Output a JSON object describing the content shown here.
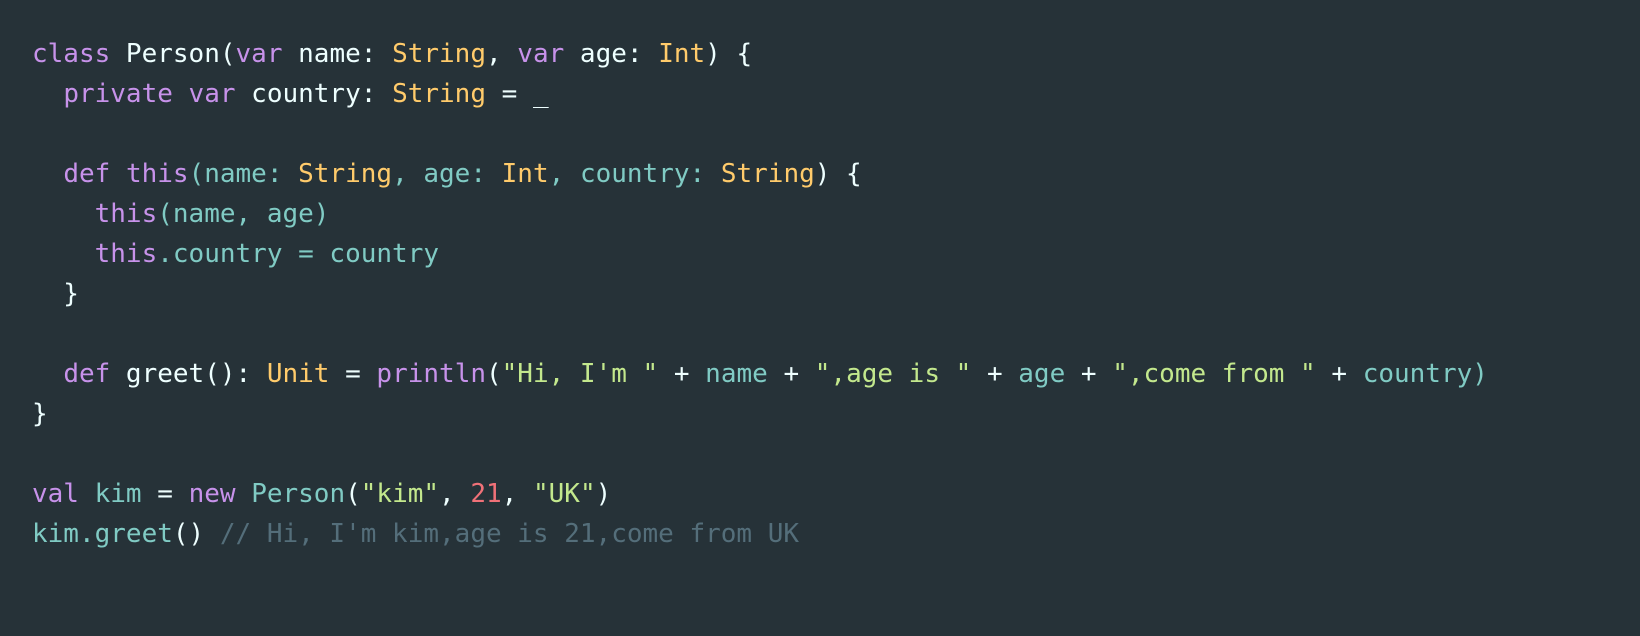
{
  "editor": {
    "language": "scala",
    "background_color": "#263238",
    "font_size_px": 26,
    "line_height_px": 40
  },
  "theme": {
    "keyword": "#c792ea",
    "plain": "#eeffff",
    "type": "#ffcb6b",
    "variable": "#80cbc4",
    "string": "#c3e88d",
    "number": "#f07178",
    "comment": "#546e7a"
  },
  "code": {
    "lines": [
      {
        "index": 1,
        "text": "class Person(var name: String, var age: Int) {",
        "tokens": [
          {
            "t": "class",
            "c": "t-kw"
          },
          {
            "t": " Person(",
            "c": "t-plain"
          },
          {
            "t": "var",
            "c": "t-kw"
          },
          {
            "t": " name: ",
            "c": "t-plain"
          },
          {
            "t": "String",
            "c": "t-type"
          },
          {
            "t": ", ",
            "c": "t-plain"
          },
          {
            "t": "var",
            "c": "t-kw"
          },
          {
            "t": " age: ",
            "c": "t-plain"
          },
          {
            "t": "Int",
            "c": "t-type"
          },
          {
            "t": ") {",
            "c": "t-plain"
          }
        ]
      },
      {
        "index": 2,
        "text": "  private var country: String = _",
        "tokens": [
          {
            "t": "  ",
            "c": "t-plain"
          },
          {
            "t": "private",
            "c": "t-kw"
          },
          {
            "t": " ",
            "c": "t-plain"
          },
          {
            "t": "var",
            "c": "t-kw"
          },
          {
            "t": " country: ",
            "c": "t-plain"
          },
          {
            "t": "String",
            "c": "t-type"
          },
          {
            "t": " = _",
            "c": "t-plain"
          }
        ]
      },
      {
        "index": 3,
        "text": "",
        "tokens": [
          {
            "t": " ",
            "c": "t-plain"
          }
        ]
      },
      {
        "index": 4,
        "text": "  def this(name: String, age: Int, country: String) {",
        "tokens": [
          {
            "t": "  ",
            "c": "t-plain"
          },
          {
            "t": "def",
            "c": "t-kw"
          },
          {
            "t": " ",
            "c": "t-plain"
          },
          {
            "t": "this",
            "c": "t-kw"
          },
          {
            "t": "(name: ",
            "c": "t-var"
          },
          {
            "t": "String",
            "c": "t-type"
          },
          {
            "t": ", ",
            "c": "t-var"
          },
          {
            "t": "age: ",
            "c": "t-var"
          },
          {
            "t": "Int",
            "c": "t-type"
          },
          {
            "t": ", ",
            "c": "t-var"
          },
          {
            "t": "country: ",
            "c": "t-var"
          },
          {
            "t": "String",
            "c": "t-type"
          },
          {
            "t": ") {",
            "c": "t-plain"
          }
        ]
      },
      {
        "index": 5,
        "text": "    this(name, age)",
        "tokens": [
          {
            "t": "    ",
            "c": "t-plain"
          },
          {
            "t": "this",
            "c": "t-kw"
          },
          {
            "t": "(name, age)",
            "c": "t-var"
          }
        ]
      },
      {
        "index": 6,
        "text": "    this.country = country",
        "tokens": [
          {
            "t": "    ",
            "c": "t-plain"
          },
          {
            "t": "this",
            "c": "t-kw"
          },
          {
            "t": ".country = country",
            "c": "t-var"
          }
        ]
      },
      {
        "index": 7,
        "text": "  }",
        "tokens": [
          {
            "t": "  }",
            "c": "t-plain"
          }
        ]
      },
      {
        "index": 8,
        "text": "",
        "tokens": [
          {
            "t": " ",
            "c": "t-plain"
          }
        ]
      },
      {
        "index": 9,
        "text": "  def greet(): Unit = println(\"Hi, I'm \" + name + \",age is \" + age + \",come from \" + country)",
        "tokens": [
          {
            "t": "  ",
            "c": "t-plain"
          },
          {
            "t": "def",
            "c": "t-kw"
          },
          {
            "t": " greet(): ",
            "c": "t-plain"
          },
          {
            "t": "Unit",
            "c": "t-type"
          },
          {
            "t": " = ",
            "c": "t-plain"
          },
          {
            "t": "println",
            "c": "t-kw"
          },
          {
            "t": "(",
            "c": "t-plain"
          },
          {
            "t": "\"Hi, I'm \"",
            "c": "t-str"
          },
          {
            "t": " + ",
            "c": "t-plain"
          },
          {
            "t": "name",
            "c": "t-var"
          },
          {
            "t": " + ",
            "c": "t-plain"
          },
          {
            "t": "\",age is \"",
            "c": "t-str"
          },
          {
            "t": " + ",
            "c": "t-plain"
          },
          {
            "t": "age",
            "c": "t-var"
          },
          {
            "t": " + ",
            "c": "t-plain"
          },
          {
            "t": "\",come from \"",
            "c": "t-str"
          },
          {
            "t": " + ",
            "c": "t-plain"
          },
          {
            "t": "country)",
            "c": "t-var"
          }
        ]
      },
      {
        "index": 10,
        "text": "}",
        "tokens": [
          {
            "t": "}",
            "c": "t-plain"
          }
        ]
      },
      {
        "index": 11,
        "text": "",
        "tokens": [
          {
            "t": " ",
            "c": "t-plain"
          }
        ]
      },
      {
        "index": 12,
        "text": "val kim = new Person(\"kim\", 21, \"UK\")",
        "tokens": [
          {
            "t": "val",
            "c": "t-kw"
          },
          {
            "t": " kim",
            "c": "t-var"
          },
          {
            "t": " = ",
            "c": "t-plain"
          },
          {
            "t": "new",
            "c": "t-kw"
          },
          {
            "t": " ",
            "c": "t-plain"
          },
          {
            "t": "Person",
            "c": "t-var"
          },
          {
            "t": "(",
            "c": "t-plain"
          },
          {
            "t": "\"kim\"",
            "c": "t-str"
          },
          {
            "t": ", ",
            "c": "t-plain"
          },
          {
            "t": "21",
            "c": "t-num"
          },
          {
            "t": ", ",
            "c": "t-plain"
          },
          {
            "t": "\"UK\"",
            "c": "t-str"
          },
          {
            "t": ")",
            "c": "t-plain"
          }
        ]
      },
      {
        "index": 13,
        "text": "kim.greet() // Hi, I'm kim,age is 21,come from UK",
        "tokens": [
          {
            "t": "kim.greet",
            "c": "t-var"
          },
          {
            "t": "()",
            "c": "t-plain"
          },
          {
            "t": " ",
            "c": "t-plain"
          },
          {
            "t": "// Hi, I'm kim,age is 21,come from UK",
            "c": "t-comment"
          }
        ]
      }
    ]
  }
}
